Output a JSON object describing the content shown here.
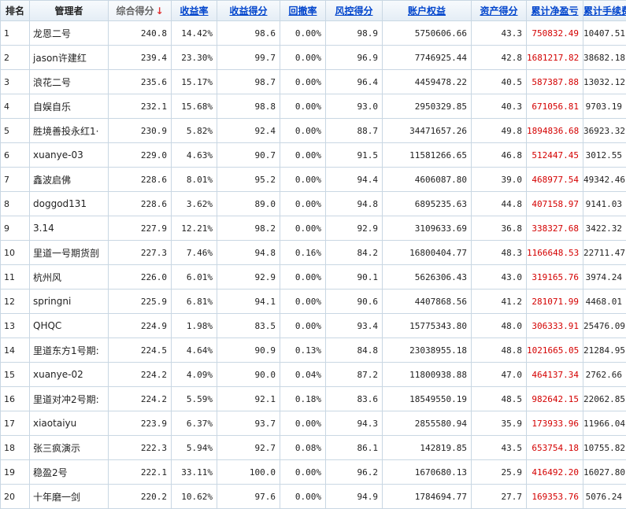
{
  "headers": [
    {
      "key": "rank",
      "label": "排名",
      "style": "plain"
    },
    {
      "key": "manager",
      "label": "管理者",
      "style": "plain"
    },
    {
      "key": "composite",
      "label": "综合得分",
      "style": "sorted",
      "arrow": "↓"
    },
    {
      "key": "return_rate",
      "label": "收益率",
      "style": "link"
    },
    {
      "key": "return_score",
      "label": "收益得分",
      "style": "link"
    },
    {
      "key": "drawdown",
      "label": "回撤率",
      "style": "link"
    },
    {
      "key": "risk_score",
      "label": "风控得分",
      "style": "link"
    },
    {
      "key": "equity",
      "label": "账户权益",
      "style": "link"
    },
    {
      "key": "asset_score",
      "label": "资产得分",
      "style": "link"
    },
    {
      "key": "net_pnl",
      "label": "累计净盈亏",
      "style": "link"
    },
    {
      "key": "fees",
      "label": "累计手续费",
      "style": "link"
    }
  ],
  "rows": [
    {
      "rank": "1",
      "manager": "龙恩二号",
      "composite": "240.8",
      "return_rate": "14.42%",
      "return_score": "98.6",
      "drawdown": "0.00%",
      "risk_score": "98.9",
      "equity": "5750606.66",
      "asset_score": "43.3",
      "net_pnl": "750832.49",
      "fees": "10407.51"
    },
    {
      "rank": "2",
      "manager": "jason许建红",
      "composite": "239.4",
      "return_rate": "23.30%",
      "return_score": "99.7",
      "drawdown": "0.00%",
      "risk_score": "96.9",
      "equity": "7746925.44",
      "asset_score": "42.8",
      "net_pnl": "1681217.82",
      "fees": "38682.18"
    },
    {
      "rank": "3",
      "manager": "浪花二号",
      "composite": "235.6",
      "return_rate": "15.17%",
      "return_score": "98.7",
      "drawdown": "0.00%",
      "risk_score": "96.4",
      "equity": "4459478.22",
      "asset_score": "40.5",
      "net_pnl": "587387.88",
      "fees": "13032.12"
    },
    {
      "rank": "4",
      "manager": "自娱自乐",
      "composite": "232.1",
      "return_rate": "15.68%",
      "return_score": "98.8",
      "drawdown": "0.00%",
      "risk_score": "93.0",
      "equity": "2950329.85",
      "asset_score": "40.3",
      "net_pnl": "671056.81",
      "fees": "9703.19"
    },
    {
      "rank": "5",
      "manager": "胜境善投永红1·",
      "composite": "230.9",
      "return_rate": "5.82%",
      "return_score": "92.4",
      "drawdown": "0.00%",
      "risk_score": "88.7",
      "equity": "34471657.26",
      "asset_score": "49.8",
      "net_pnl": "1894836.68",
      "fees": "36923.32"
    },
    {
      "rank": "6",
      "manager": "xuanye-03",
      "composite": "229.0",
      "return_rate": "4.63%",
      "return_score": "90.7",
      "drawdown": "0.00%",
      "risk_score": "91.5",
      "equity": "11581266.65",
      "asset_score": "46.8",
      "net_pnl": "512447.45",
      "fees": "3012.55"
    },
    {
      "rank": "7",
      "manager": "鑫波启佛",
      "composite": "228.6",
      "return_rate": "8.01%",
      "return_score": "95.2",
      "drawdown": "0.00%",
      "risk_score": "94.4",
      "equity": "4606087.80",
      "asset_score": "39.0",
      "net_pnl": "468977.54",
      "fees": "49342.46"
    },
    {
      "rank": "8",
      "manager": "doggod131",
      "composite": "228.6",
      "return_rate": "3.62%",
      "return_score": "89.0",
      "drawdown": "0.00%",
      "risk_score": "94.8",
      "equity": "6895235.63",
      "asset_score": "44.8",
      "net_pnl": "407158.97",
      "fees": "9141.03"
    },
    {
      "rank": "9",
      "manager": "3.14",
      "composite": "227.9",
      "return_rate": "12.21%",
      "return_score": "98.2",
      "drawdown": "0.00%",
      "risk_score": "92.9",
      "equity": "3109633.69",
      "asset_score": "36.8",
      "net_pnl": "338327.68",
      "fees": "3422.32"
    },
    {
      "rank": "10",
      "manager": "里道一号期货剖",
      "composite": "227.3",
      "return_rate": "7.46%",
      "return_score": "94.8",
      "drawdown": "0.16%",
      "risk_score": "84.2",
      "equity": "16800404.77",
      "asset_score": "48.3",
      "net_pnl": "1166648.53",
      "fees": "22711.47"
    },
    {
      "rank": "11",
      "manager": "杭州风",
      "composite": "226.0",
      "return_rate": "6.01%",
      "return_score": "92.9",
      "drawdown": "0.00%",
      "risk_score": "90.1",
      "equity": "5626306.43",
      "asset_score": "43.0",
      "net_pnl": "319165.76",
      "fees": "3974.24"
    },
    {
      "rank": "12",
      "manager": "springni",
      "composite": "225.9",
      "return_rate": "6.81%",
      "return_score": "94.1",
      "drawdown": "0.00%",
      "risk_score": "90.6",
      "equity": "4407868.56",
      "asset_score": "41.2",
      "net_pnl": "281071.99",
      "fees": "4468.01"
    },
    {
      "rank": "13",
      "manager": "QHQC",
      "composite": "224.9",
      "return_rate": "1.98%",
      "return_score": "83.5",
      "drawdown": "0.00%",
      "risk_score": "93.4",
      "equity": "15775343.80",
      "asset_score": "48.0",
      "net_pnl": "306333.91",
      "fees": "25476.09"
    },
    {
      "rank": "14",
      "manager": "里道东方1号期:",
      "composite": "224.5",
      "return_rate": "4.64%",
      "return_score": "90.9",
      "drawdown": "0.13%",
      "risk_score": "84.8",
      "equity": "23038955.18",
      "asset_score": "48.8",
      "net_pnl": "1021665.05",
      "fees": "21284.95"
    },
    {
      "rank": "15",
      "manager": "xuanye-02",
      "composite": "224.2",
      "return_rate": "4.09%",
      "return_score": "90.0",
      "drawdown": "0.04%",
      "risk_score": "87.2",
      "equity": "11800938.88",
      "asset_score": "47.0",
      "net_pnl": "464137.34",
      "fees": "2762.66"
    },
    {
      "rank": "16",
      "manager": "里道对冲2号期:",
      "composite": "224.2",
      "return_rate": "5.59%",
      "return_score": "92.1",
      "drawdown": "0.18%",
      "risk_score": "83.6",
      "equity": "18549550.19",
      "asset_score": "48.5",
      "net_pnl": "982642.15",
      "fees": "22062.85"
    },
    {
      "rank": "17",
      "manager": "xiaotaiyu",
      "composite": "223.9",
      "return_rate": "6.37%",
      "return_score": "93.7",
      "drawdown": "0.00%",
      "risk_score": "94.3",
      "equity": "2855580.94",
      "asset_score": "35.9",
      "net_pnl": "173933.96",
      "fees": "11966.04"
    },
    {
      "rank": "18",
      "manager": "张三疯演示",
      "composite": "222.3",
      "return_rate": "5.94%",
      "return_score": "92.7",
      "drawdown": "0.08%",
      "risk_score": "86.1",
      "equity": "142819.85",
      "asset_score": "43.5",
      "net_pnl": "653754.18",
      "fees": "10755.82"
    },
    {
      "rank": "19",
      "manager": "稳盈2号",
      "composite": "222.1",
      "return_rate": "33.11%",
      "return_score": "100.0",
      "drawdown": "0.00%",
      "risk_score": "96.2",
      "equity": "1670680.13",
      "asset_score": "25.9",
      "net_pnl": "416492.20",
      "fees": "16027.80"
    },
    {
      "rank": "20",
      "manager": "十年磨一剑",
      "composite": "220.2",
      "return_rate": "10.62%",
      "return_score": "97.6",
      "drawdown": "0.00%",
      "risk_score": "94.9",
      "equity": "1784694.77",
      "asset_score": "27.7",
      "net_pnl": "169353.76",
      "fees": "5076.24"
    }
  ],
  "colors": {
    "header_link": "#0044cc",
    "net_pnl_text": "#d40000",
    "sort_arrow": "#e23232",
    "border": "#c9d7e3"
  }
}
